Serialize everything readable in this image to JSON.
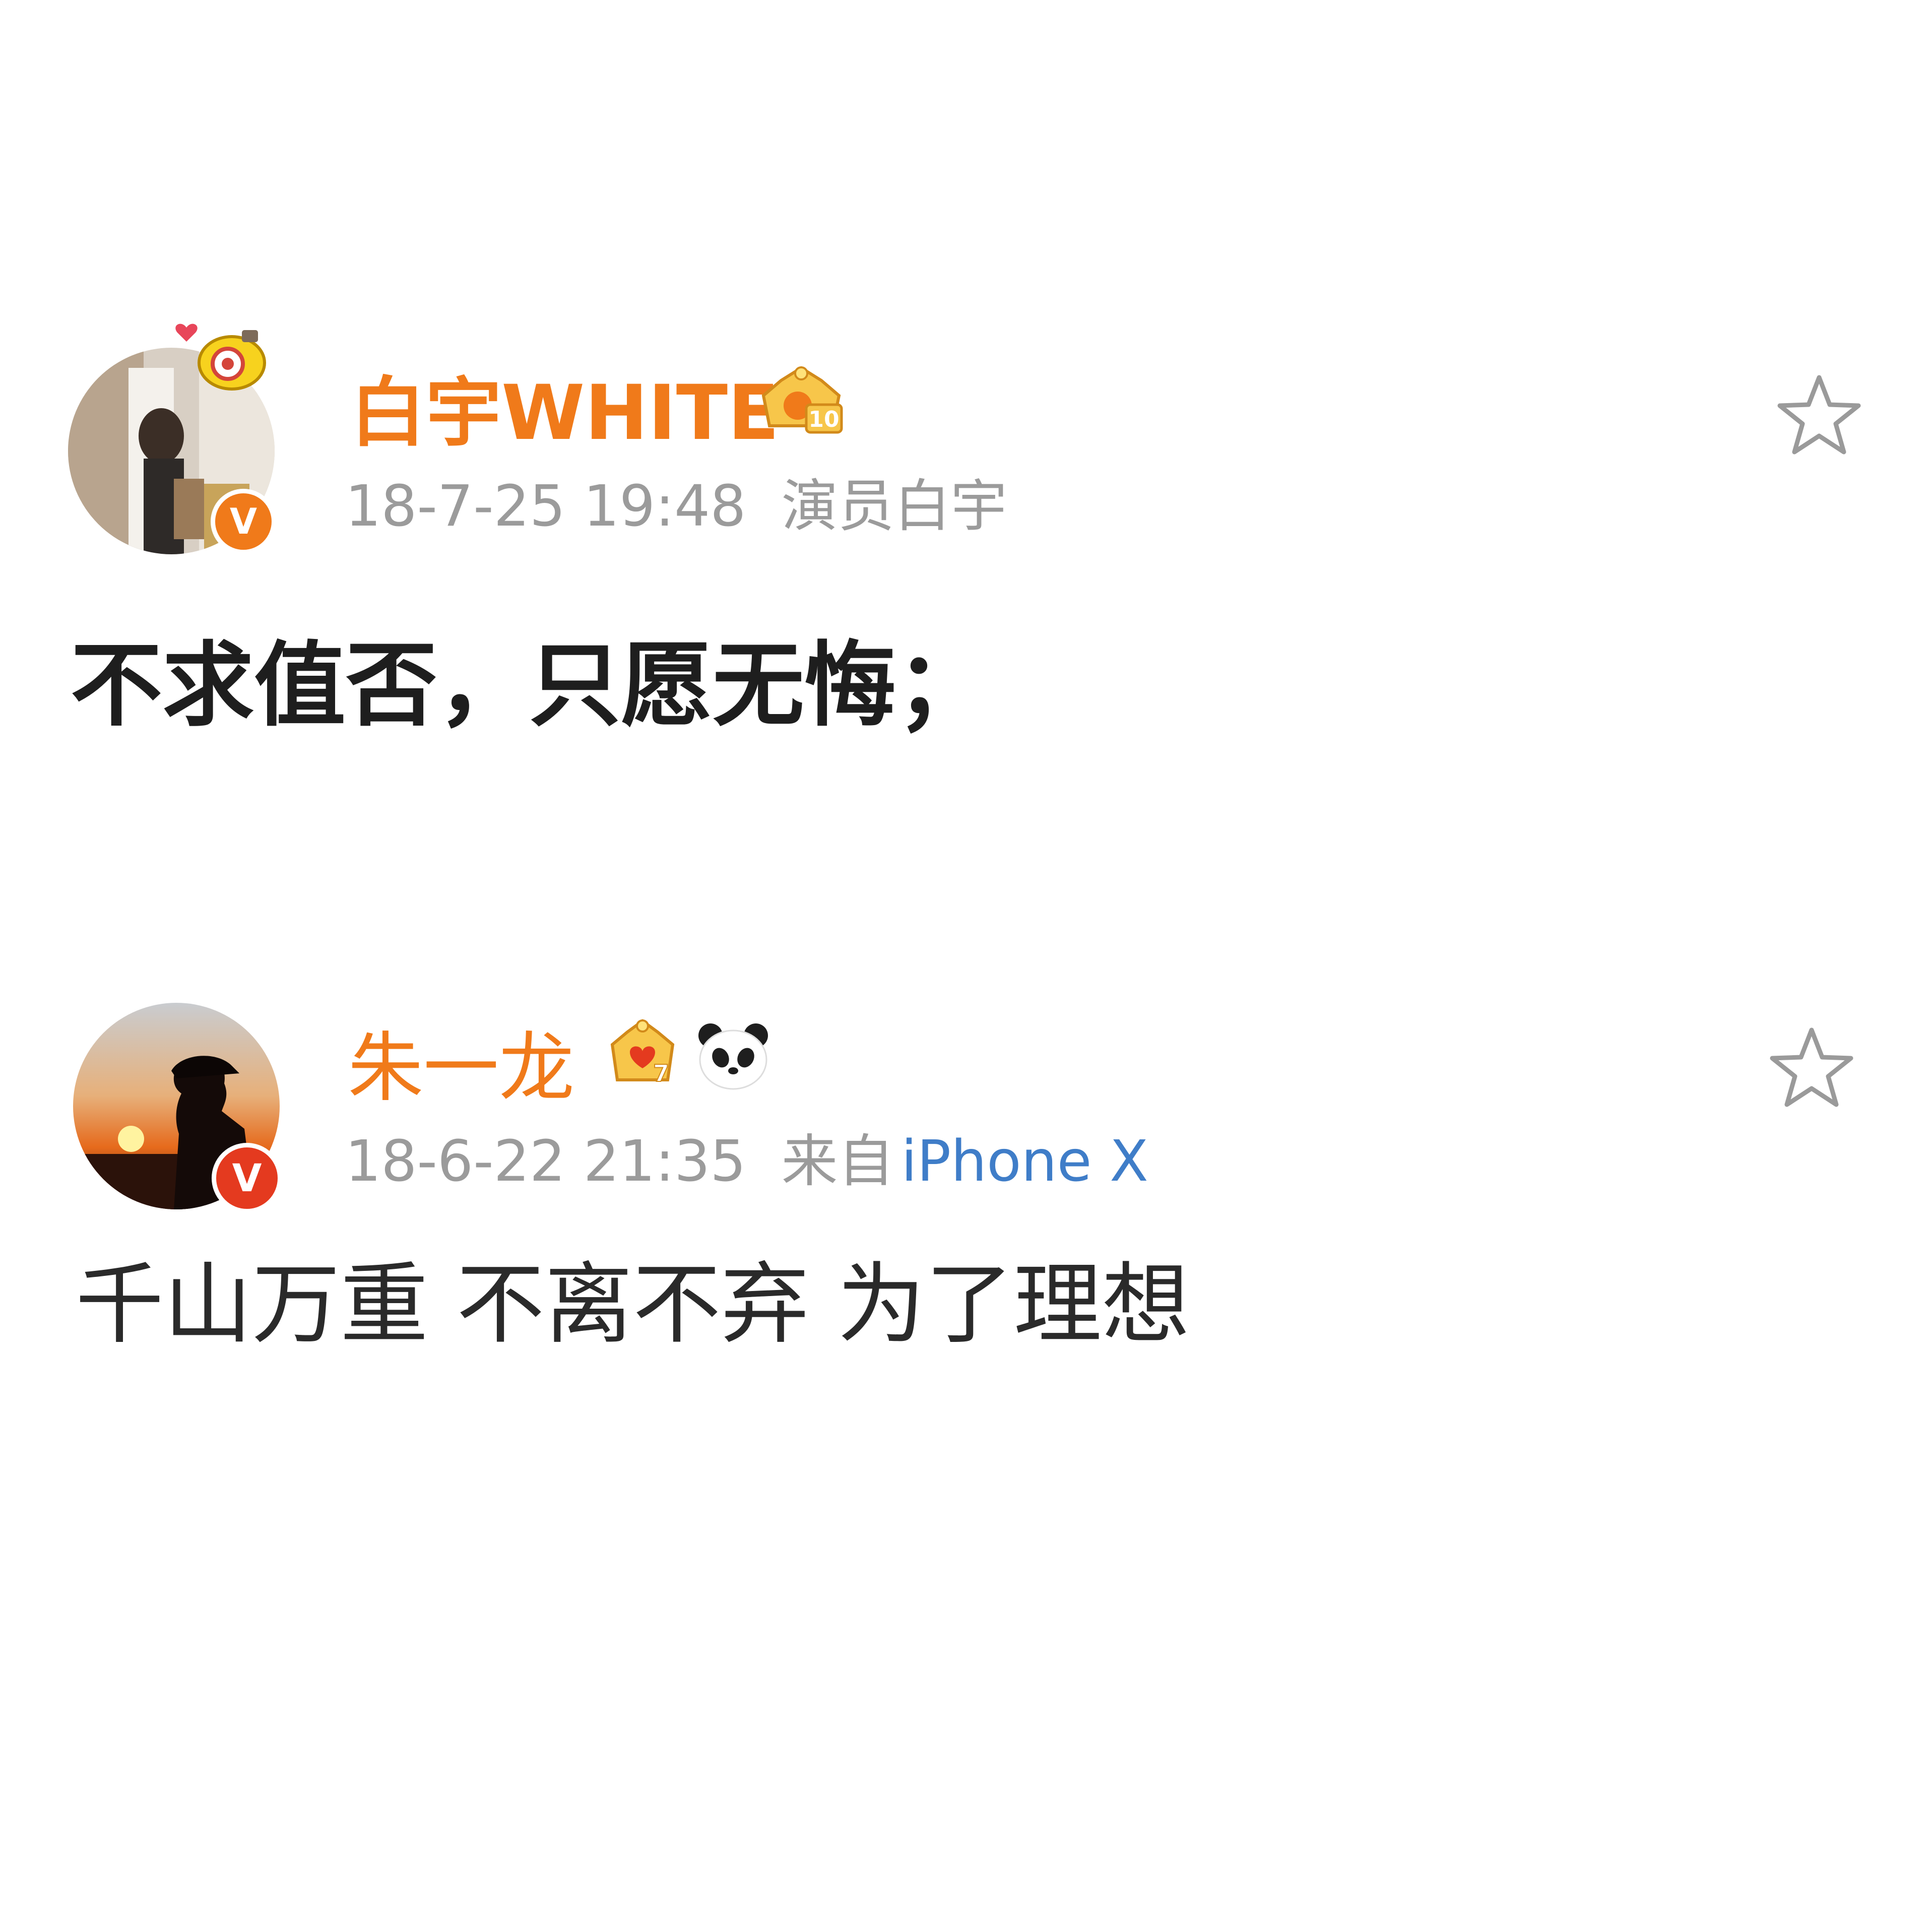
{
  "posts": [
    {
      "username": "白宇WHITE",
      "timestamp": "18-7-25 19:48",
      "source": "演员白宇",
      "source_device": "",
      "body": "不求值否，只愿无悔；",
      "verified_badge": "V",
      "level_badge": "10",
      "badge_icons": [
        "crown-level-10-icon",
        "camera-pendant-icon"
      ],
      "favorite_icon": "star-outline-icon"
    },
    {
      "username": "朱一龙",
      "timestamp": "18-6-22 21:35",
      "source": "来自",
      "source_device": "iPhone X",
      "body": "千山万重 不离不弃 为了理想",
      "verified_badge": "V",
      "level_badge": "7",
      "badge_icons": [
        "crown-level-7-icon",
        "panda-icon"
      ],
      "favorite_icon": "star-outline-icon"
    }
  ],
  "colors": {
    "username": "#f07a1a",
    "meta": "#9b9b9b",
    "link": "#3f7dc8",
    "body_text": "#1e1e1e",
    "verified_orange": "#f07a1a",
    "verified_red": "#e43a1f"
  }
}
